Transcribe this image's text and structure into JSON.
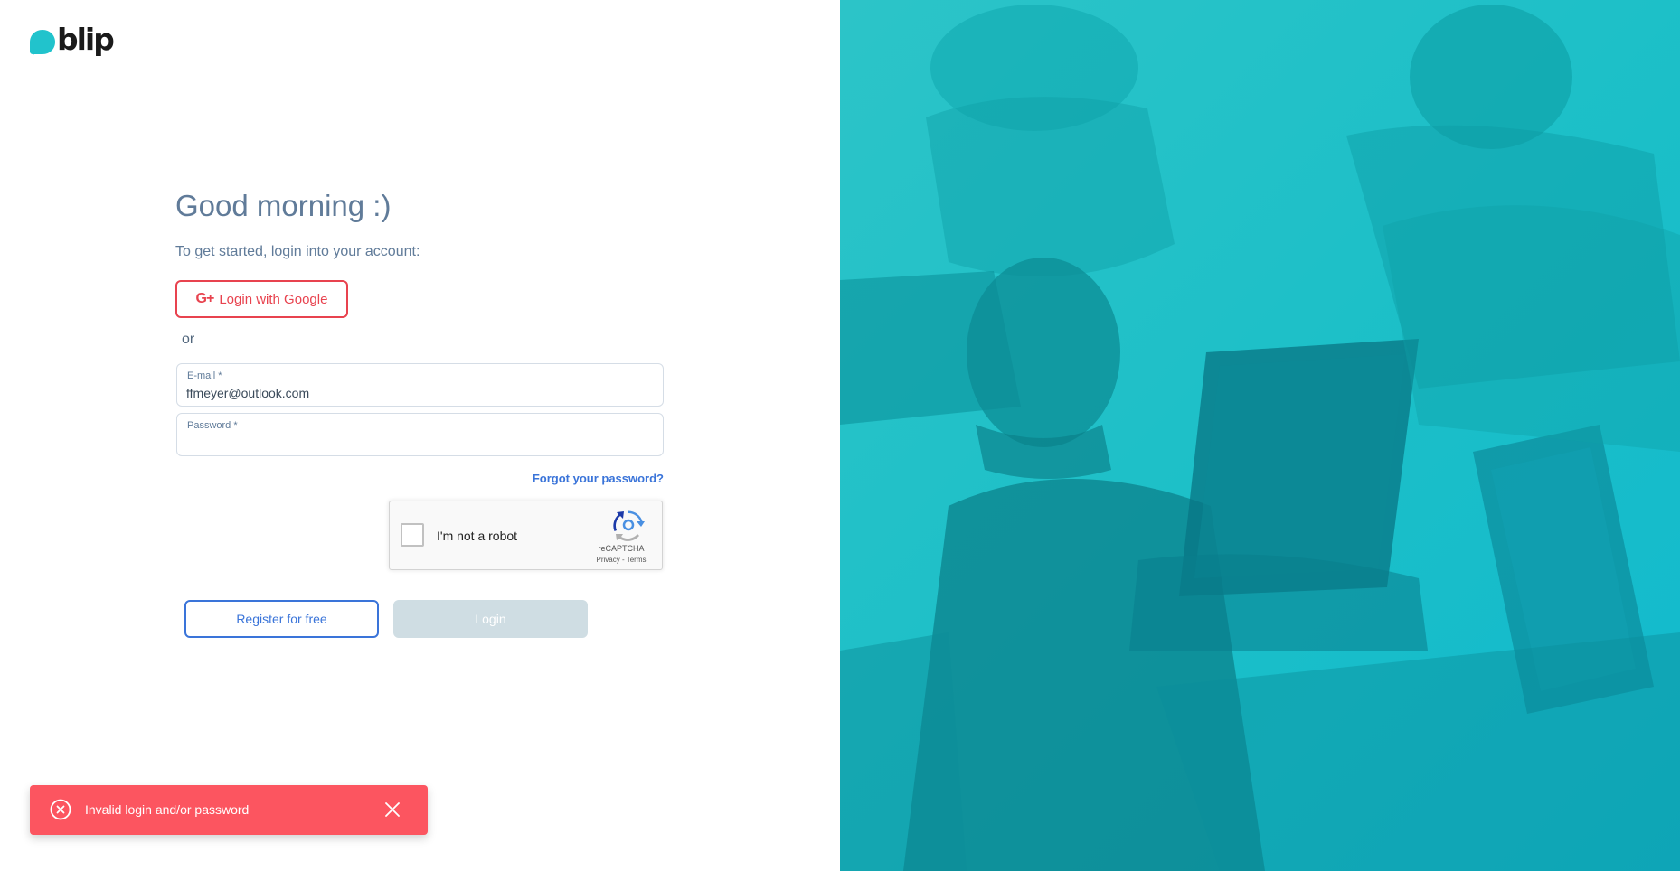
{
  "brand": {
    "logo_text": "blip",
    "accent_color": "#21c3cc"
  },
  "login": {
    "greeting": "Good morning :)",
    "subtitle": "To get started, login into your account:",
    "google_button_label": "Login with Google",
    "google_button_icon": "google-plus-icon",
    "or_text": "or",
    "email": {
      "label": "E-mail *",
      "value": "ffmeyer@outlook.com"
    },
    "password": {
      "label": "Password *",
      "value": ""
    },
    "forgot_password_label": "Forgot your password?",
    "recaptcha": {
      "label": "I'm not a robot",
      "brand": "reCAPTCHA",
      "links": "Privacy - Terms"
    },
    "register_button_label": "Register for free",
    "login_button_label": "Login"
  },
  "toast": {
    "message": "Invalid login and/or password",
    "icon": "error-circle-icon",
    "close_icon": "close-icon",
    "color": "#fc5560"
  },
  "colors": {
    "heading": "#607b99",
    "link": "#3a74d9",
    "google_red": "#e8434f",
    "login_disabled": "#cfdde3"
  }
}
